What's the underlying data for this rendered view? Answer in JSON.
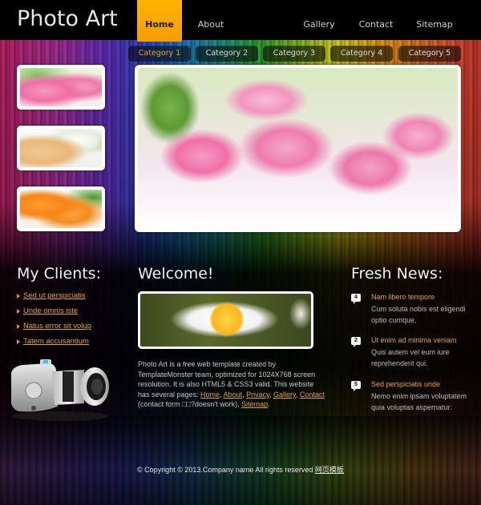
{
  "header": {
    "logo": "Photo Art",
    "nav": [
      {
        "label": "Home",
        "active": true
      },
      {
        "label": "About"
      },
      {
        "label": "Gallery"
      },
      {
        "label": "Contact"
      },
      {
        "label": "Sitemap"
      }
    ],
    "accent_color": "#ffb400"
  },
  "categories": [
    {
      "label": "Category 1",
      "active": true
    },
    {
      "label": "Category 2"
    },
    {
      "label": "Category 3"
    },
    {
      "label": "Category 4"
    },
    {
      "label": "Category 5"
    }
  ],
  "thumbnails": [
    {
      "subject": "pink carnations"
    },
    {
      "subject": "spa reed diffuser and white flowers"
    },
    {
      "subject": "orange roses"
    }
  ],
  "hero": {
    "subject": "pink fringed tulips"
  },
  "clients": {
    "title": "My Clients:",
    "items": [
      "Sed ut perspiciatis",
      "Unde omnis iste",
      "Natus error sit volup",
      "Tatem accusantium"
    ]
  },
  "welcome": {
    "title": "Welcome!",
    "image_subject": "white daisy",
    "text_1": "Photo Art is a free web template created by TemplateMonster team, optimized for 1024X768 screen resolution. It is also HTML5 & CSS3 valid. This website has several pages: ",
    "links": [
      "Home",
      "About",
      "Privacy",
      "Gallery",
      "Contact",
      "Sitemap"
    ],
    "contact_note": " (contact form □□?doesn't work), ",
    "sep": ", ",
    "end": "."
  },
  "news": {
    "title": "Fresh News:",
    "items": [
      {
        "badge": "4",
        "title": "Nam libero tempore",
        "body": "Cum soluta nobis est eligendi optio cumque."
      },
      {
        "badge": "2",
        "title": "Ut enim ad minima veniam",
        "body": "Quis autem vel eum iure reprehenderit qui."
      },
      {
        "badge": "5",
        "title": "Sed perspiciatis unde",
        "body": "Nemo enim ipsam voluptatem quia voluptas aspernatur."
      }
    ]
  },
  "footer": {
    "text": "© Copyright © 2013.Company name All rights reserved ",
    "link": "网页模板"
  }
}
